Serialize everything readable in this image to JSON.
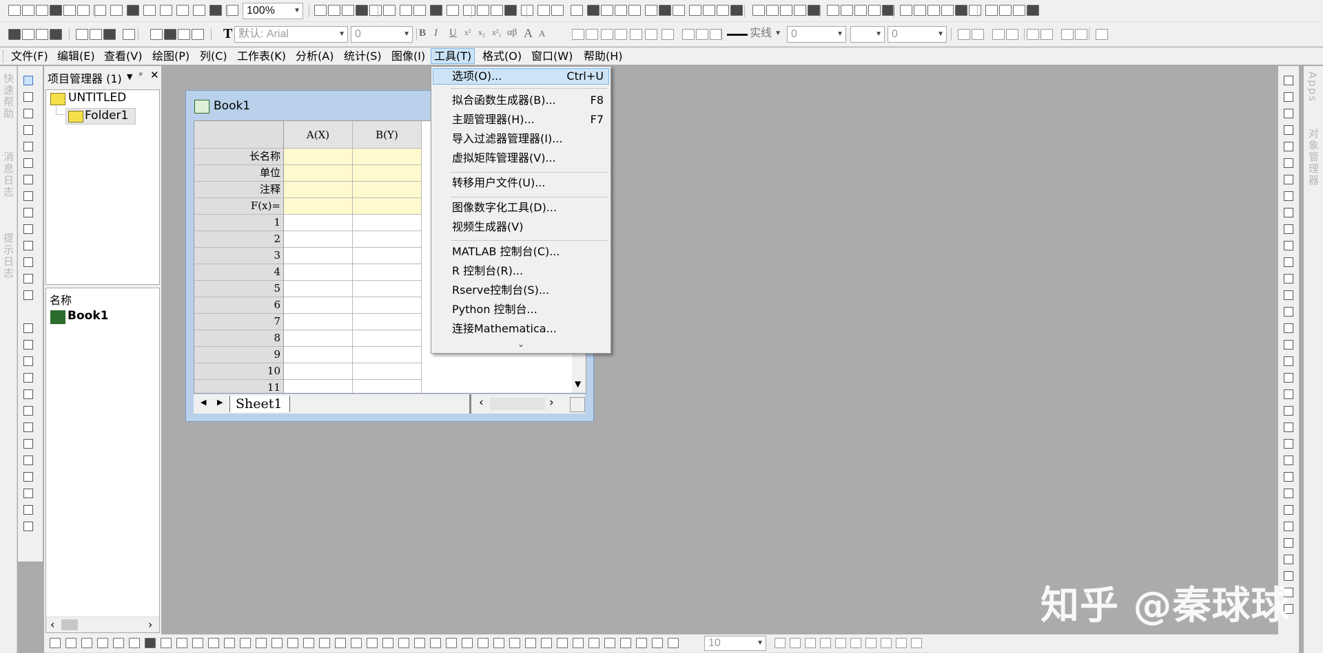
{
  "toolbar1": {
    "zoom": "100%"
  },
  "toolbar2": {
    "font_name": "默认: Arial",
    "font_size": "0",
    "bold": "B",
    "italic": "I",
    "underline": "U",
    "superscript": "x²",
    "subscript": "x₂",
    "superSub": "x²₁",
    "greek": "αβ",
    "larger": "A",
    "smaller": "A",
    "line_style": "实线",
    "line_width": "0",
    "fill_pattern_width": "0",
    "text_tool": "T"
  },
  "menubar": {
    "items": [
      "文件(F)",
      "编辑(E)",
      "查看(V)",
      "绘图(P)",
      "列(C)",
      "工作表(K)",
      "分析(A)",
      "统计(S)",
      "图像(I)",
      "工具(T)",
      "格式(O)",
      "窗口(W)",
      "帮助(H)"
    ]
  },
  "tools_menu": {
    "items": [
      {
        "label": "选项(O)...",
        "shortcut": "Ctrl+U"
      },
      {
        "label": "拟合函数生成器(B)...",
        "shortcut": "F8"
      },
      {
        "label": "主题管理器(H)...",
        "shortcut": "F7"
      },
      {
        "label": "导入过滤器管理器(I)...",
        "shortcut": ""
      },
      {
        "label": "虚拟矩阵管理器(V)...",
        "shortcut": ""
      },
      {
        "label": "转移用户文件(U)...",
        "shortcut": ""
      },
      {
        "label": "图像数字化工具(D)...",
        "shortcut": ""
      },
      {
        "label": "视频生成器(V)",
        "shortcut": ""
      },
      {
        "label": "MATLAB 控制台(C)...",
        "shortcut": ""
      },
      {
        "label": "R 控制台(R)...",
        "shortcut": ""
      },
      {
        "label": "Rserve控制台(S)...",
        "shortcut": ""
      },
      {
        "label": "Python 控制台...",
        "shortcut": ""
      },
      {
        "label": "连接Mathematica...",
        "shortcut": ""
      }
    ],
    "more_arrow": "⌄"
  },
  "left_vertical_tabs": [
    "快速帮助",
    "消息日志",
    "提示日志"
  ],
  "right_vertical_tabs": [
    "Apps",
    "对象管理器"
  ],
  "project_manager": {
    "title": "项目管理器 (1)",
    "root": "UNTITLED",
    "folder": "Folder1",
    "list_header": "名称",
    "list_item": "Book1"
  },
  "book": {
    "title": "Book1",
    "columns": [
      "A(X)",
      "B(Y)"
    ],
    "header_rows": [
      "长名称",
      "单位",
      "注释",
      "F(x)="
    ],
    "rows": [
      "1",
      "2",
      "3",
      "4",
      "5",
      "6",
      "7",
      "8",
      "9",
      "10",
      "11"
    ],
    "sheet_tab": "Sheet1"
  },
  "bottom_toolbar": {
    "size_value": "10"
  },
  "watermark": "知乎 @秦球球",
  "colors": {
    "workspace": "#ababab",
    "highlight_cells": "#fffacd",
    "title_bar": "#b9d1ea",
    "menu_highlight": "#cde4f7"
  }
}
